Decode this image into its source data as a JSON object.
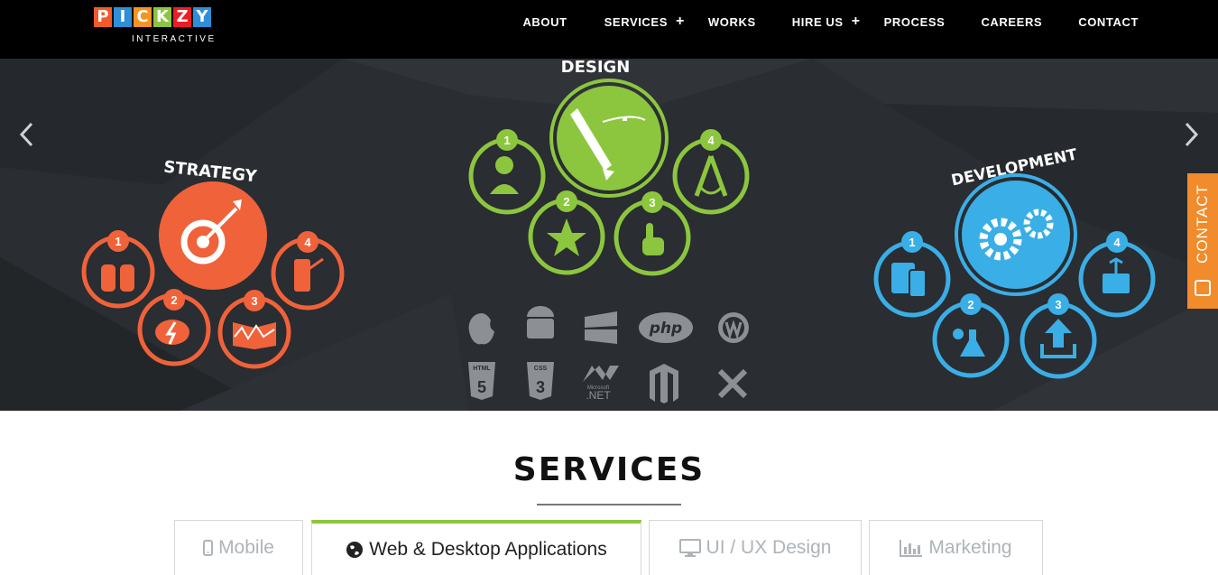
{
  "brand": {
    "letters": [
      "P",
      "I",
      "C",
      "K",
      "Z",
      "Y"
    ],
    "letter_colors": [
      "#f15a29",
      "#2e8fd6",
      "#f7931e",
      "#8cc63e",
      "#ed1c24",
      "#2e8fd6"
    ],
    "tagline": "INTERACTIVE"
  },
  "nav": {
    "items": [
      {
        "label": "ABOUT",
        "has_plus": false
      },
      {
        "label": "SERVICES",
        "has_plus": true
      },
      {
        "label": "WORKS",
        "has_plus": false
      },
      {
        "label": "HIRE US",
        "has_plus": true
      },
      {
        "label": "PROCESS",
        "has_plus": false
      },
      {
        "label": "CAREERS",
        "has_plus": false
      },
      {
        "label": "CONTACT",
        "has_plus": false
      }
    ],
    "plus": "+"
  },
  "hero": {
    "strategy": {
      "title": "STRATEGY",
      "color": "#f0623a",
      "nums": [
        "1",
        "2",
        "3",
        "4"
      ]
    },
    "design": {
      "title": "DESIGN",
      "color": "#8cc63e",
      "nums": [
        "1",
        "2",
        "3",
        "4"
      ]
    },
    "development": {
      "title": "DEVELOPMENT",
      "color": "#3aaee6",
      "nums": [
        "1",
        "2",
        "3",
        "4"
      ]
    },
    "tech_labels": {
      "php": "php",
      "html": "HTML",
      "css": "CSS",
      "html_num": "5",
      "css_num": "3",
      "net": ".NET",
      "ms": "Microsoft"
    },
    "contact_tab": "CONTACT"
  },
  "services": {
    "title": "SERVICES",
    "tabs": [
      {
        "label": "Mobile",
        "icon": "mobile-icon",
        "active": false
      },
      {
        "label": "Web & Desktop Applications",
        "icon": "globe-icon",
        "active": true
      },
      {
        "label": "UI / UX Design",
        "icon": "monitor-icon",
        "active": false
      },
      {
        "label": "Marketing",
        "icon": "bar-chart-icon",
        "active": false
      }
    ]
  },
  "colors": {
    "accent_green": "#8cc63e",
    "orange": "#f0623a",
    "blue": "#3aaee6",
    "contact_orange": "#f18b2b"
  }
}
